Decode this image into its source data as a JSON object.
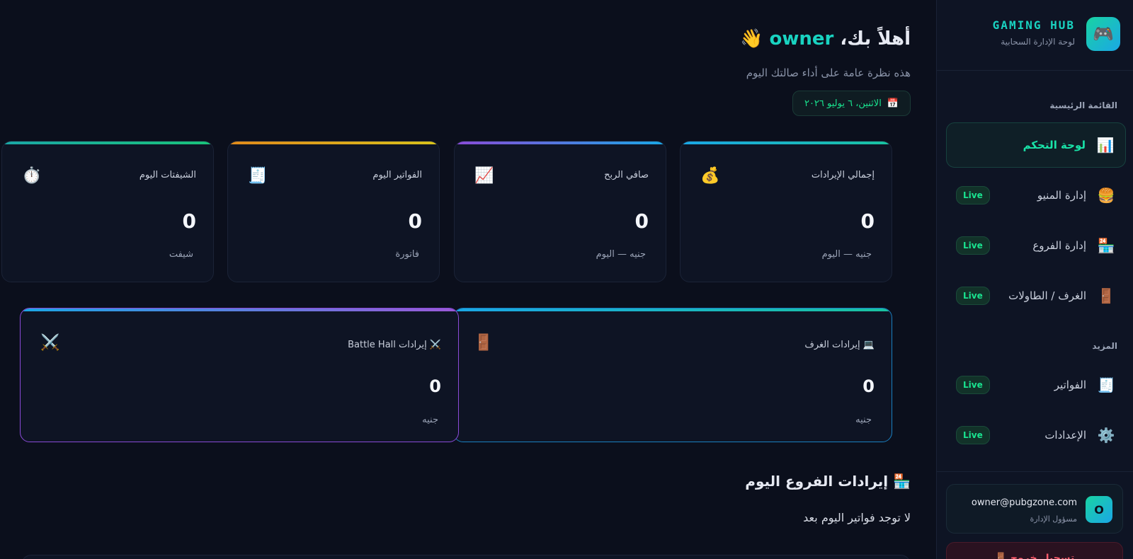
{
  "sidebar": {
    "brand_title": "GAMING HUB",
    "brand_subtitle": "لوحة الإدارة السحابية",
    "brand_icon": "🎮",
    "section_main": "القائمة الرئيسية",
    "section_more": "المزيد",
    "items": [
      {
        "label": "لوحة التحكم",
        "icon": "📊",
        "badge": ""
      },
      {
        "label": "إدارة المنيو",
        "icon": "🍔",
        "badge": "Live"
      },
      {
        "label": "إدارة الفروع",
        "icon": "🏪",
        "badge": "Live"
      },
      {
        "label": "الغرف / الطاولات",
        "icon": "🚪",
        "badge": "Live"
      },
      {
        "label": "الفواتير",
        "icon": "🧾",
        "badge": "Live"
      },
      {
        "label": "الإعدادات",
        "icon": "⚙️",
        "badge": "Live"
      }
    ],
    "user": {
      "avatar": "O",
      "email": "owner@pubgzone.com",
      "role": "مسؤول الإدارة"
    },
    "logout_label": "🚪 تسجيل خروج"
  },
  "header": {
    "greeting_prefix": "أهلاً بك،",
    "username": "owner",
    "wave": "👋",
    "subtitle": "هذه نظرة عامة على أداء صالتك اليوم",
    "date_icon": "📅",
    "date": "الاثنين، ٦ يوليو ٢٠٢٦"
  },
  "stats": [
    {
      "label": "إجمالي الإيرادات",
      "icon": "💰",
      "value": "0",
      "unit": "جنيه — اليوم",
      "accent": "#19c3a0"
    },
    {
      "label": "صافي الربح",
      "icon": "📈",
      "value": "0",
      "unit": "جنيه — اليوم",
      "accent": "#3a7bd5"
    },
    {
      "label": "الفواتير اليوم",
      "icon": "🧾",
      "value": "0",
      "unit": "فاتورة",
      "accent": "#d8a21b"
    },
    {
      "label": "الشيفتات اليوم",
      "icon": "⏱️",
      "value": "0",
      "unit": "شيفت",
      "accent": "#19c37a"
    }
  ],
  "revenue_cards": [
    {
      "label": "💻 إيرادات الغرف",
      "icon": "🚪",
      "value": "0",
      "unit": "جنيه",
      "accent": "#1aa7e6"
    },
    {
      "label": "⚔️ إيرادات Battle Hall",
      "icon": "⚔️",
      "value": "0",
      "unit": "جنيه",
      "accent": "#9b59d8"
    }
  ],
  "branches": {
    "title": "🏪 إيرادات الفروع اليوم",
    "empty_text": "لا توجد فواتير اليوم بعد"
  }
}
